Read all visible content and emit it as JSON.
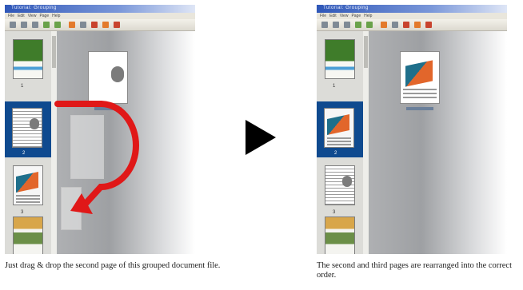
{
  "left": {
    "window_title": "Tutorial: Grouping",
    "menu": [
      "File",
      "Edit",
      "View",
      "Page",
      "Help"
    ],
    "thumbnails": [
      {
        "label": "1",
        "kind": "green"
      },
      {
        "label": "2",
        "kind": "text"
      },
      {
        "label": "3",
        "kind": "orange"
      },
      {
        "label": "4",
        "kind": "photo"
      }
    ],
    "caption": "Just drag & drop the second page of this grouped document file."
  },
  "right": {
    "window_title": "Tutorial: Grouping",
    "menu": [
      "File",
      "Edit",
      "View",
      "Page",
      "Help"
    ],
    "thumbnails": [
      {
        "label": "1",
        "kind": "green"
      },
      {
        "label": "2",
        "kind": "orange"
      },
      {
        "label": "3",
        "kind": "text"
      },
      {
        "label": "4",
        "kind": "photo"
      }
    ],
    "caption": "The second and third pages are rearranged into the correct order."
  },
  "colors": {
    "arrow": "#e01818",
    "selection": "#0f4a8f",
    "next_arrow": "#000000"
  },
  "icons": [
    "drag-arrow-icon",
    "next-step-icon"
  ]
}
